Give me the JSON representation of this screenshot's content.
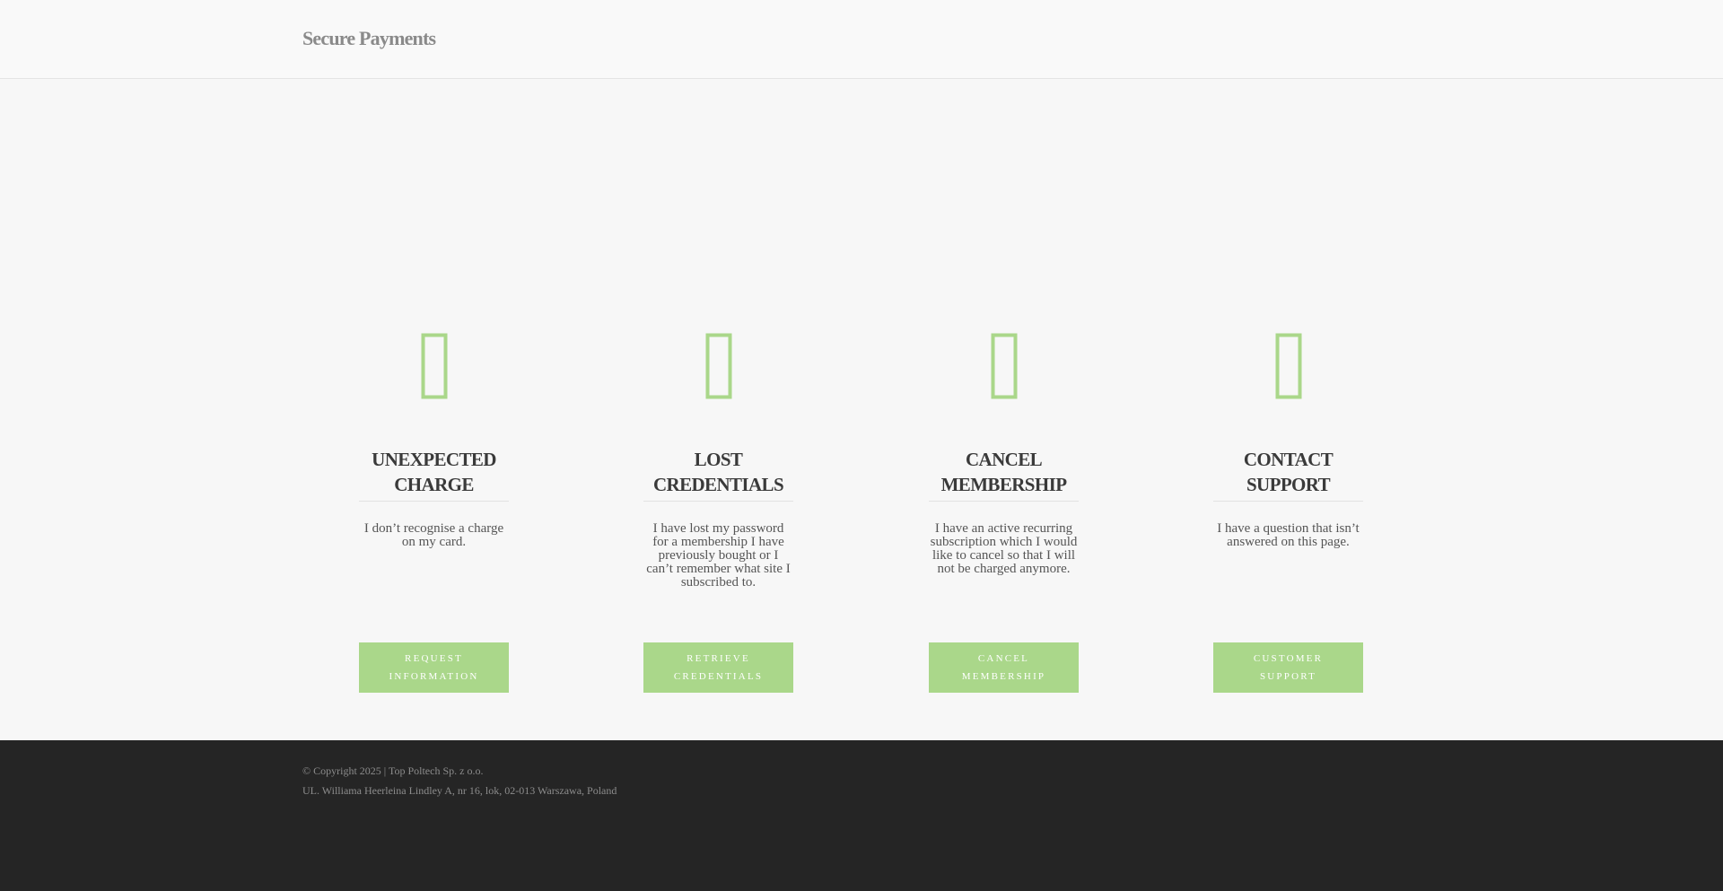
{
  "header": {
    "logo_text": "Secure Payments"
  },
  "accent_color": "#aad78a",
  "cards": [
    {
      "icon": "credit-card-icon",
      "title_line1": "UNEXPECTED",
      "title_line2": "CHARGE",
      "description": "I don’t recognise a charge on my card.",
      "button_line1": "REQUEST",
      "button_line2": "INFORMATION"
    },
    {
      "icon": "key-icon",
      "title_line1": "LOST",
      "title_line2": "CREDENTIALS",
      "description": "I have lost my password for a membership I have previously bought or I can’t remember what site I subscribed to.",
      "button_line1": "RETRIEVE",
      "button_line2": "CREDENTIALS"
    },
    {
      "icon": "cancel-icon",
      "title_line1": "CANCEL",
      "title_line2": "MEMBERSHIP",
      "description": "I have an active recurring subscription which I would like to cancel so that I will not be charged anymore.",
      "button_line1": "CANCEL",
      "button_line2": "MEMBERSHIP"
    },
    {
      "icon": "support-icon",
      "title_line1": "CONTACT",
      "title_line2": "SUPPORT",
      "description": "I have a question that isn’t answered on this page.",
      "button_line1": "CUSTOMER",
      "button_line2": "SUPPORT"
    }
  ],
  "footer": {
    "copyright": "© Copyright 2025 | Top Poltech Sp. z o.o.",
    "address": "UL. Williama Heerleina Lindley A, nr 16, lok, 02-013 Warszawa, Poland"
  }
}
